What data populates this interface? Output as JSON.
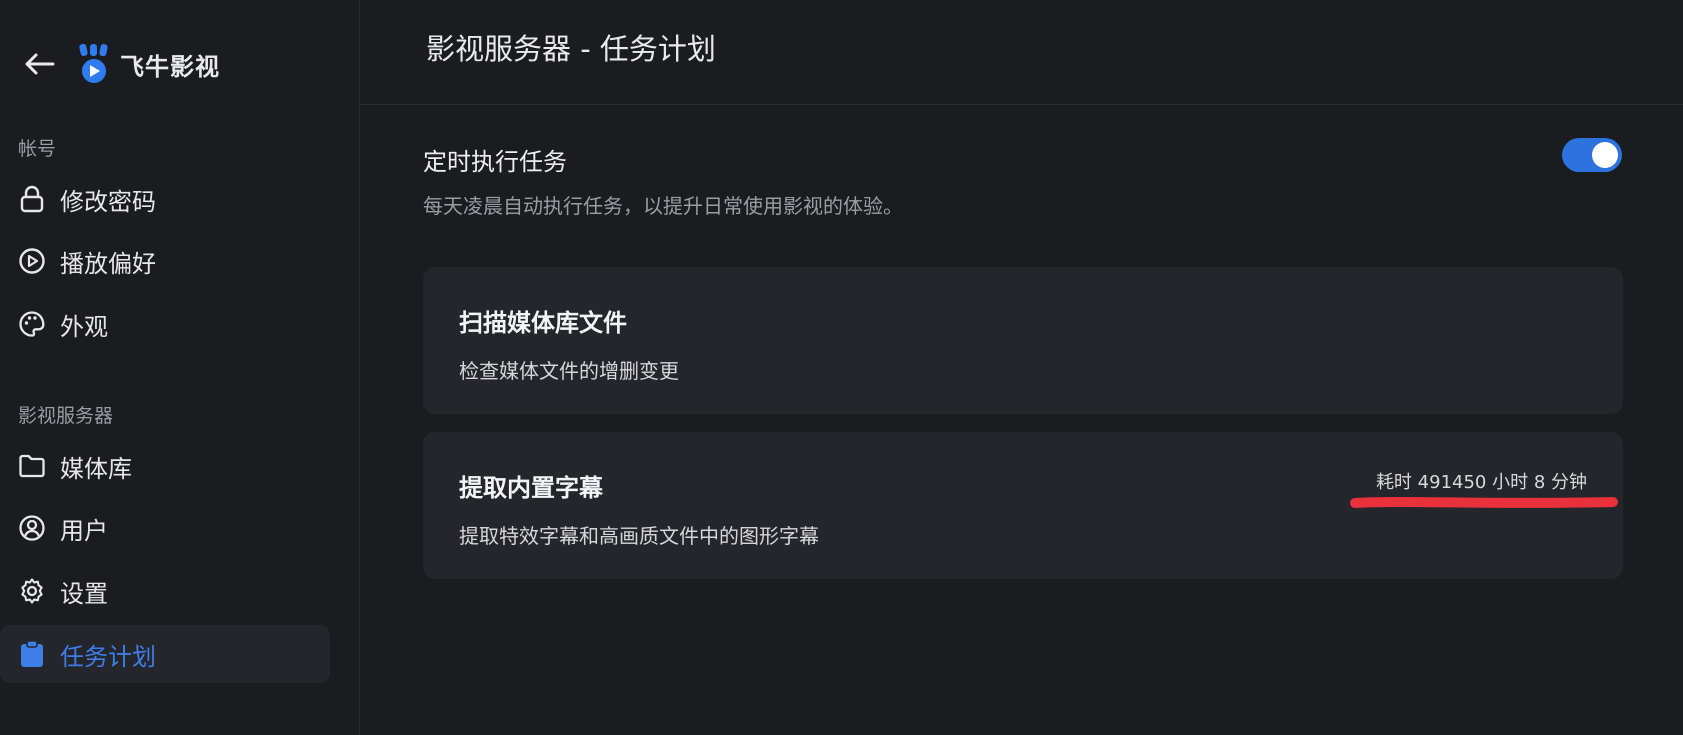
{
  "brand": {
    "name": "飞牛影视",
    "accent": "#2f7cf0"
  },
  "sidebar": {
    "section_account": "帐号",
    "section_server": "影视服务器",
    "items": [
      {
        "label": "修改密码",
        "icon": "lock-icon"
      },
      {
        "label": "播放偏好",
        "icon": "play-circle-icon"
      },
      {
        "label": "外观",
        "icon": "palette-icon"
      },
      {
        "label": "媒体库",
        "icon": "folder-icon"
      },
      {
        "label": "用户",
        "icon": "user-circle-icon"
      },
      {
        "label": "设置",
        "icon": "gear-icon"
      },
      {
        "label": "任务计划",
        "icon": "clipboard-icon",
        "active": true
      }
    ]
  },
  "main": {
    "title": "影视服务器 - 任务计划",
    "scheduled": {
      "title": "定时执行任务",
      "description": "每天凌晨自动执行任务，以提升日常使用影视的体验。",
      "enabled": true
    },
    "tasks": [
      {
        "title": "扫描媒体库文件",
        "description": "检查媒体文件的增删变更",
        "status": ""
      },
      {
        "title": "提取内置字幕",
        "description": "提取特效字幕和高画质文件中的图形字幕",
        "status": "耗时 491450 小时 8 分钟"
      }
    ]
  },
  "colors": {
    "toggle_on": "#2d73e0",
    "active_nav": "#3d7ee8",
    "annotation": "#e8313b"
  }
}
